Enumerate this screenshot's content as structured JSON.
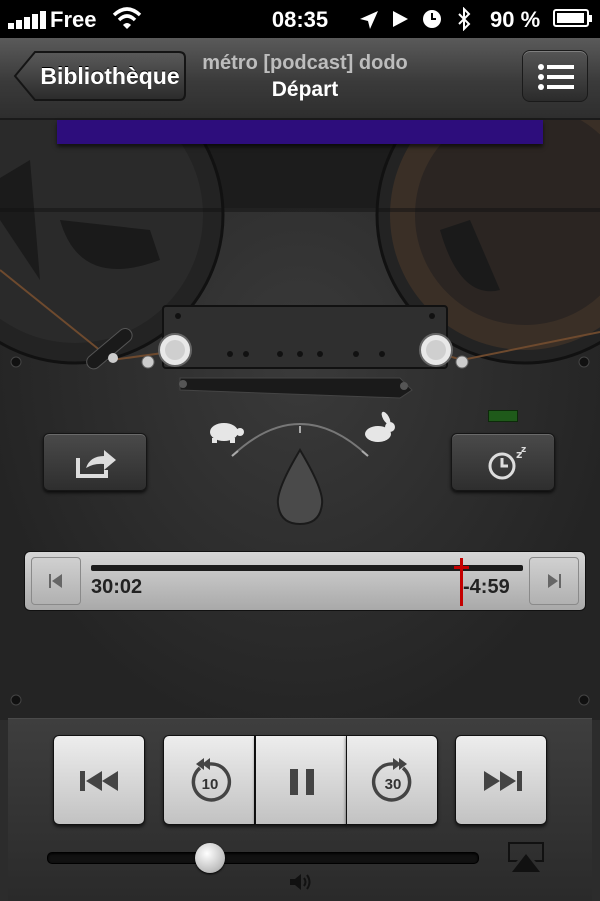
{
  "status_bar": {
    "carrier": "Free",
    "time": "08:35",
    "battery_text": "90 %",
    "battery_level": 0.9,
    "icons": [
      "signal-bars-icon",
      "wifi-icon",
      "location-arrow-icon",
      "play-icon",
      "alarm-clock-icon",
      "bluetooth-icon",
      "battery-icon"
    ]
  },
  "nav": {
    "back_label": "Bibliothèque",
    "title_line1": "métro [podcast] dodo",
    "title_line2": "Départ",
    "list_icon": "list-icon"
  },
  "deck": {
    "tape_window_color": "#2d0d7c",
    "speed_slow_icon": "turtle-icon",
    "speed_fast_icon": "rabbit-icon",
    "share_icon": "share-icon",
    "sleep_timer_icon": "sleep-timer-icon",
    "led_color": "#1f5a1a"
  },
  "scrubber": {
    "elapsed": "30:02",
    "remaining": "-4:59",
    "progress": 0.858,
    "playhead_color": "#c40000"
  },
  "controls": {
    "previous_icon": "skip-previous-icon",
    "rewind_icon": "rewind-10-icon",
    "rewind_label": "10",
    "pause_icon": "pause-icon",
    "forward_icon": "forward-30-icon",
    "forward_label": "30",
    "next_icon": "skip-next-icon",
    "volume_level": 0.38,
    "volume_icon": "speaker-icon",
    "airplay_icon": "airplay-icon"
  }
}
